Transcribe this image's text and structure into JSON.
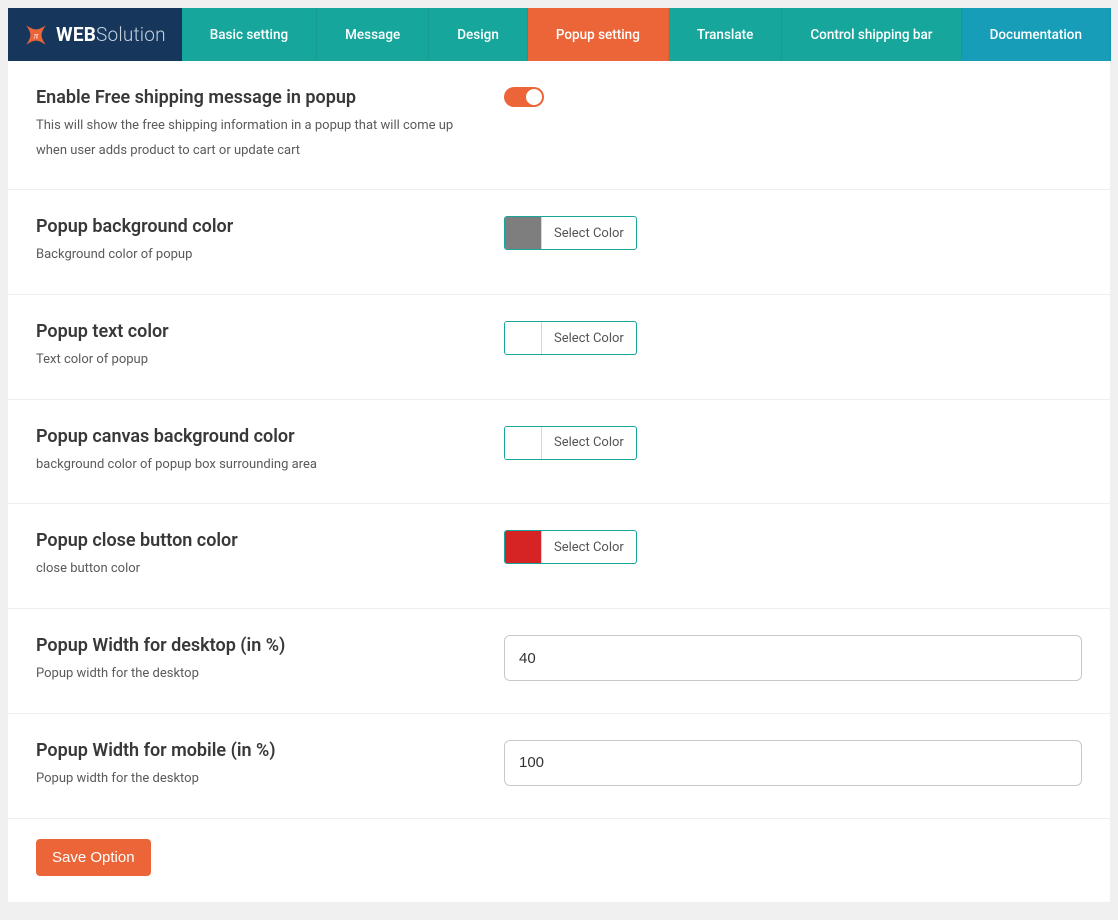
{
  "logo": {
    "text_bold": "WEB",
    "text_thin": "Solution"
  },
  "tabs": [
    {
      "label": "Basic setting",
      "style": "teal",
      "active": false
    },
    {
      "label": "Message",
      "style": "teal",
      "active": false
    },
    {
      "label": "Design",
      "style": "teal",
      "active": false
    },
    {
      "label": "Popup setting",
      "style": "orange",
      "active": true
    },
    {
      "label": "Translate",
      "style": "teal",
      "active": false
    },
    {
      "label": "Control shipping bar",
      "style": "teal",
      "active": false
    },
    {
      "label": "Documentation",
      "style": "blue",
      "active": false
    }
  ],
  "rows": {
    "enable": {
      "title": "Enable Free shipping message in popup",
      "desc": "This will show the free shipping information in a popup that will come up when user adds product to cart or update cart",
      "value": true
    },
    "bgcolor": {
      "title": "Popup background color",
      "desc": "Background color of popup",
      "btn": "Select Color",
      "swatch": "#7e7e7e"
    },
    "txtcolor": {
      "title": "Popup text color",
      "desc": "Text color of popup",
      "btn": "Select Color",
      "swatch": "#ffffff"
    },
    "canvas": {
      "title": "Popup canvas background color",
      "desc": "background color of popup box surrounding area",
      "btn": "Select Color",
      "swatch": "#ffffff"
    },
    "closebtn": {
      "title": "Popup close button color",
      "desc": "close button color",
      "btn": "Select Color",
      "swatch": "#d62323"
    },
    "wdesktop": {
      "title": "Popup Width for desktop (in %)",
      "desc": "Popup width for the desktop",
      "value": "40"
    },
    "wmobile": {
      "title": "Popup Width for mobile (in %)",
      "desc": "Popup width for the desktop",
      "value": "100"
    }
  },
  "save_label": "Save Option"
}
